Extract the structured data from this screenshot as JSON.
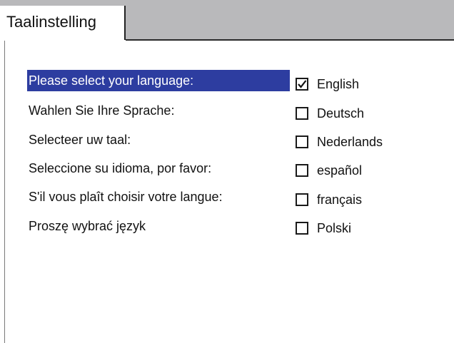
{
  "tab": {
    "label": "Taalinstelling"
  },
  "prompts": [
    {
      "text": "Please select your language:",
      "selected": true
    },
    {
      "text": "Wahlen Sie Ihre Sprache:",
      "selected": false
    },
    {
      "text": "Selecteer uw taal:",
      "selected": false
    },
    {
      "text": "Seleccione su idioma, por favor:",
      "selected": false
    },
    {
      "text": "S'il vous plaît choisir votre langue:",
      "selected": false
    },
    {
      "text": "Proszę wybrać język",
      "selected": false
    }
  ],
  "languages": [
    {
      "label": "English",
      "checked": true
    },
    {
      "label": "Deutsch",
      "checked": false
    },
    {
      "label": "Nederlands",
      "checked": false
    },
    {
      "label": "español",
      "checked": false
    },
    {
      "label": "français",
      "checked": false
    },
    {
      "label": "Polski",
      "checked": false
    }
  ],
  "colors": {
    "selection_background": "#2d3da0",
    "tabbar_background": "#b9b9bb"
  },
  "icons": {
    "checked": "checkmark-icon"
  }
}
